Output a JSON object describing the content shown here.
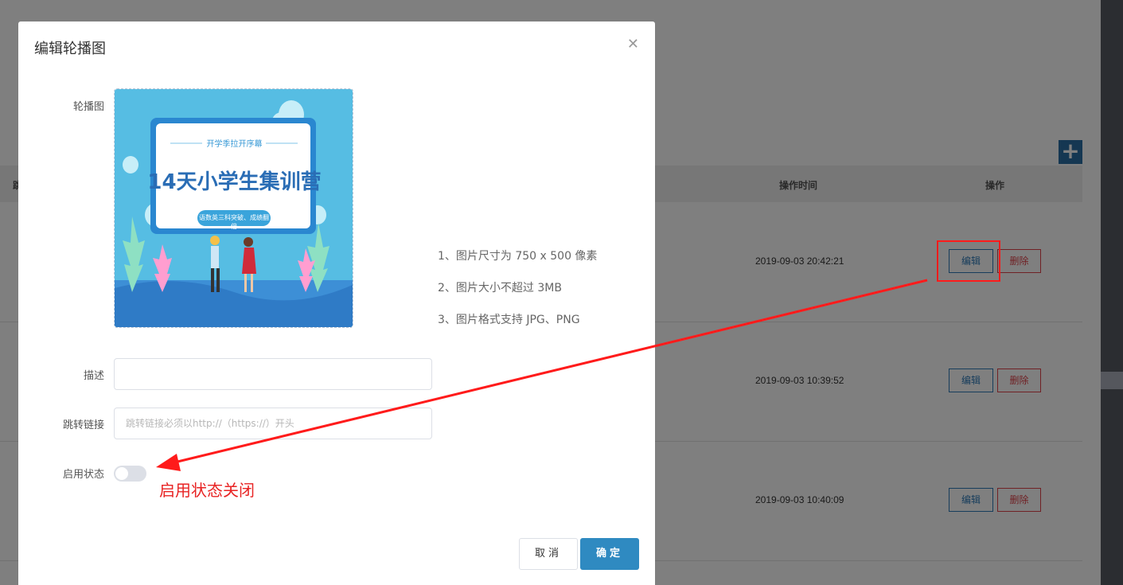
{
  "background": {
    "add_icon": "plus-icon",
    "columns": {
      "left": "跳",
      "time": "操作时间",
      "action": "操作"
    },
    "rows": [
      {
        "time": "2019-09-03 20:42:21",
        "edit": "编辑",
        "delete": "删除"
      },
      {
        "time": "2019-09-03 10:39:52",
        "edit": "编辑",
        "delete": "删除"
      },
      {
        "time": "2019-09-03 10:40:09",
        "edit": "编辑",
        "delete": "删除"
      }
    ]
  },
  "modal": {
    "title": "编辑轮播图",
    "close_icon": "close-icon",
    "banner_label": "轮播图",
    "banner": {
      "subtitle": "开学季拉开序幕",
      "title": "14天小学生集训营",
      "pill": "语数英三科突破、成绩翻倍"
    },
    "tips": [
      "1、图片尺寸为 750 x 500 像素",
      "2、图片大小不超过 3MB",
      "3、图片格式支持 JPG、PNG"
    ],
    "desc_label": "描述",
    "desc_value": "",
    "link_label": "跳转链接",
    "link_placeholder": "跳转链接必须以http://（https://）开头",
    "status_label": "启用状态",
    "status_enabled": false,
    "cancel_label": "取消",
    "ok_label": "确定"
  },
  "annotation": {
    "text": "启用状态关闭",
    "color": "#e82323"
  },
  "colors": {
    "primary": "#2f8ac1",
    "danger": "#e0434a",
    "annotation": "#ff1b1b"
  }
}
